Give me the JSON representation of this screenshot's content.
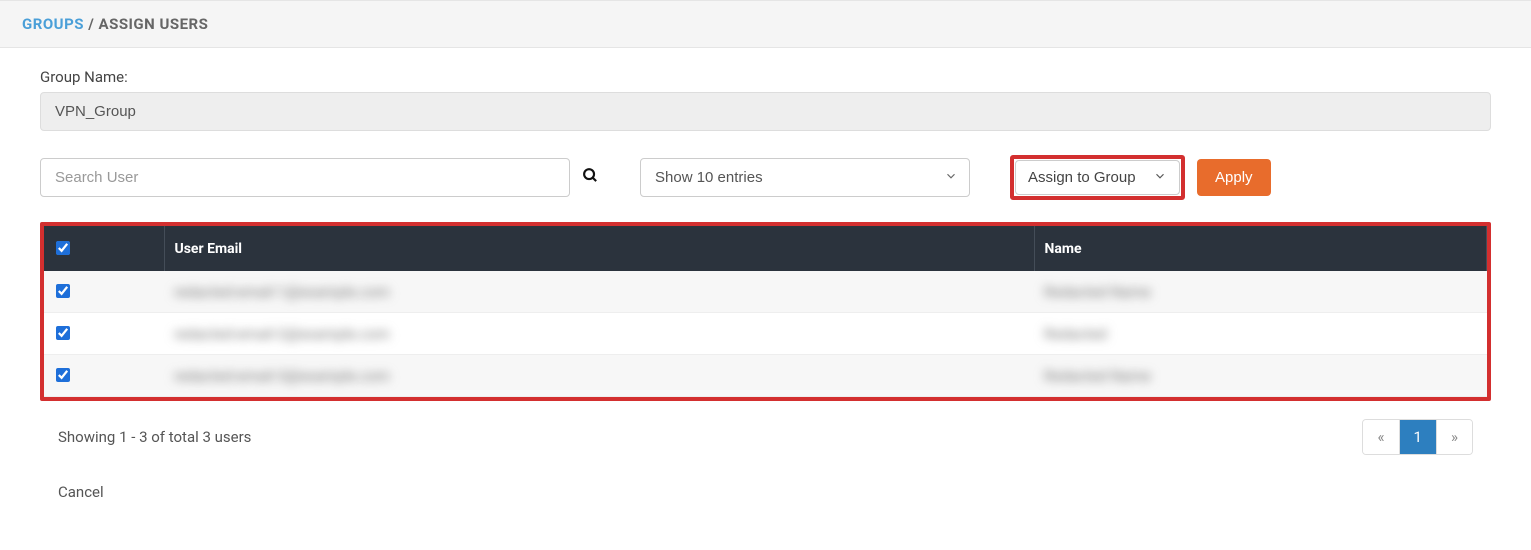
{
  "breadcrumb": {
    "root": "GROUPS",
    "sep": " / ",
    "current": "ASSIGN USERS"
  },
  "group": {
    "label": "Group Name:",
    "value": "VPN_Group"
  },
  "search": {
    "placeholder": "Search User"
  },
  "entries_select": {
    "value": "Show 10 entries"
  },
  "action_select": {
    "value": "Assign to Group"
  },
  "apply_label": "Apply",
  "table": {
    "select_all": true,
    "headers": {
      "email": "User Email",
      "name": "Name"
    },
    "rows": [
      {
        "checked": true,
        "email": "redacted-email-1@example.com",
        "name": "Redacted Name"
      },
      {
        "checked": true,
        "email": "redacted-email-2@example.com",
        "name": "Redacted"
      },
      {
        "checked": true,
        "email": "redacted-email-3@example.com",
        "name": "Redacted Name"
      }
    ]
  },
  "footer": {
    "showing": "Showing 1 - 3 of total 3 users",
    "prev": "«",
    "page": "1",
    "next": "»"
  },
  "cancel_label": "Cancel"
}
